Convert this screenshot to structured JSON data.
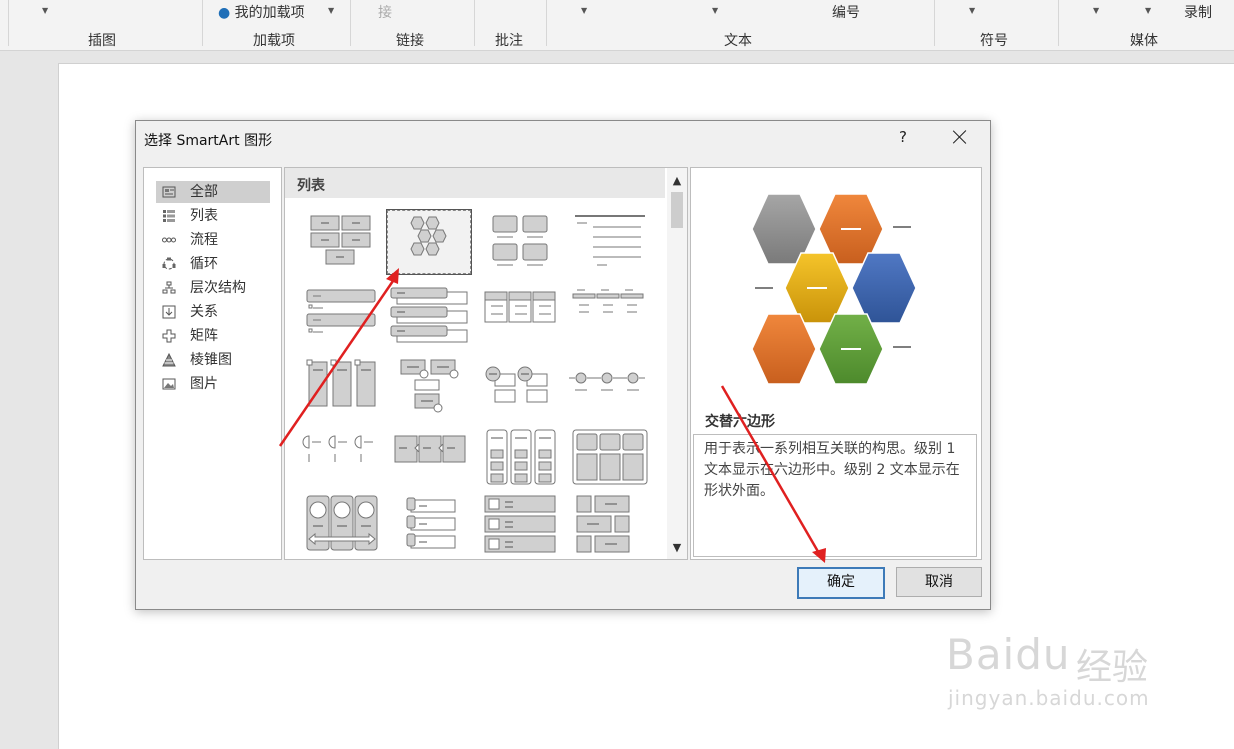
{
  "ribbon": {
    "groups": [
      "插图",
      "加载项",
      "链接",
      "批注",
      "文本",
      "符号",
      "媒体"
    ],
    "top_items": [
      "我的加载项",
      "接",
      "编号",
      "录制"
    ]
  },
  "dialog": {
    "title": "选择 SmartArt 图形",
    "help_label": "?",
    "categories": [
      {
        "label": "全部",
        "icon": "all-icon"
      },
      {
        "label": "列表",
        "icon": "list-icon"
      },
      {
        "label": "流程",
        "icon": "process-icon"
      },
      {
        "label": "循环",
        "icon": "cycle-icon"
      },
      {
        "label": "层次结构",
        "icon": "hierarchy-icon"
      },
      {
        "label": "关系",
        "icon": "relationship-icon"
      },
      {
        "label": "矩阵",
        "icon": "matrix-icon"
      },
      {
        "label": "棱锥图",
        "icon": "pyramid-icon"
      },
      {
        "label": "图片",
        "icon": "picture-icon"
      }
    ],
    "selected_category": "全部",
    "gallery_header": "列表",
    "preview": {
      "name": "交替六边形",
      "description": "用于表示一系列相互关联的构思。级别 1 文本显示在六边形中。级别 2 文本显示在形状外面。",
      "hex_text": "—",
      "colors": {
        "gray": "#8c8c8c",
        "orange": "#e0752d",
        "yellow": "#e8b10a",
        "blue": "#3c66b0",
        "green": "#5e9e3a"
      }
    },
    "ok_label": "确定",
    "cancel_label": "取消"
  },
  "watermark": {
    "brand": "Baidu",
    "cn": "经验",
    "url": "jingyan.baidu.com"
  },
  "colors": {
    "annotation_arrow": "#e02020",
    "accent": "#3d7ab8"
  }
}
